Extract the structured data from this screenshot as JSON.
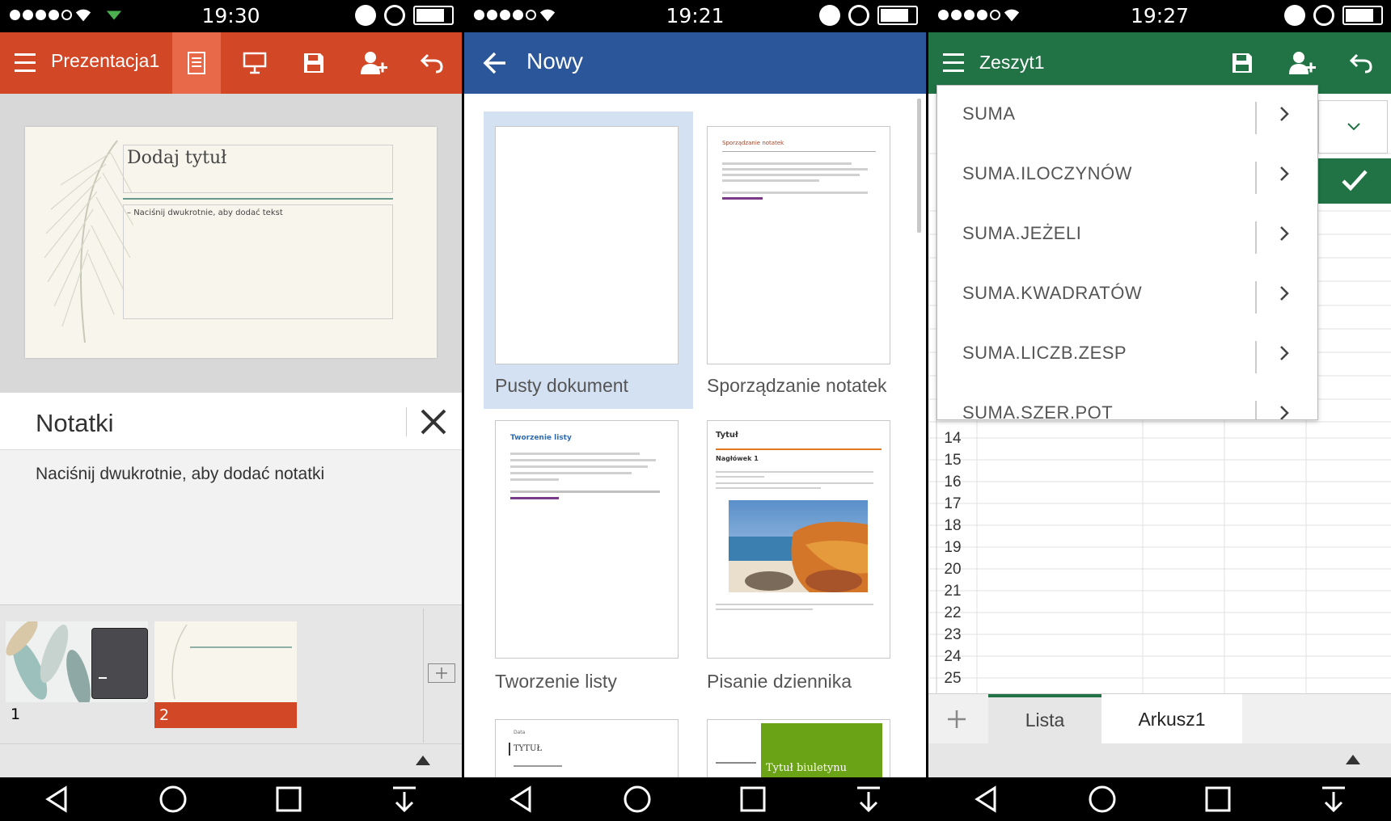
{
  "powerpoint": {
    "status_time": "19:30",
    "title": "Prezentacja1",
    "slide": {
      "title_placeholder": "Dodaj tytuł",
      "body_placeholder": "Naciśnij dwukrotnie, aby dodać tekst"
    },
    "notes": {
      "title": "Notatki",
      "placeholder": "Naciśnij dwukrotnie, aby dodać notatki"
    },
    "thumbnails": [
      "1",
      "2"
    ],
    "selected_slide": "2",
    "accent_color": "#d24726"
  },
  "word": {
    "status_time": "19:21",
    "title": "Nowy",
    "templates": [
      {
        "label": "Pusty dokument"
      },
      {
        "label": "Sporządzanie notatek",
        "heading": "Sporządzanie notatek"
      },
      {
        "label": "Tworzenie listy",
        "heading": "Tworzenie listy"
      },
      {
        "label": "Pisanie dziennika",
        "heading": "Tytuł",
        "subheading": "Nagłówek 1"
      },
      {
        "label": "",
        "heading": "TYTUŁ",
        "small": "Data"
      },
      {
        "label": "",
        "heading": "Tytuł biuletynu"
      }
    ],
    "accent_color": "#2b579a"
  },
  "excel": {
    "status_time": "19:27",
    "title": "Zeszyt1",
    "functions": [
      "SUMA",
      "SUMA.ILOCZYNÓW",
      "SUMA.JEŻELI",
      "SUMA.KWADRATÓW",
      "SUMA.LICZB.ZESP",
      "SUMA.SZER.POT"
    ],
    "rows": [
      "14",
      "15",
      "16",
      "17",
      "18",
      "19",
      "20",
      "21",
      "22",
      "23",
      "24",
      "25"
    ],
    "sheets": [
      "Lista",
      "Arkusz1"
    ],
    "accent_color": "#217346"
  }
}
